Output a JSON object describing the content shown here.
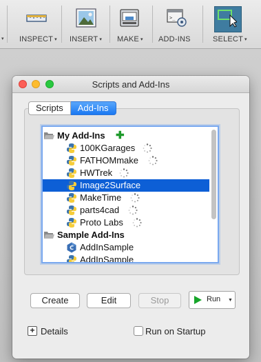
{
  "toolbar": {
    "items": [
      {
        "label": "INSPECT",
        "icon": "ruler-icon",
        "has_menu": true
      },
      {
        "label": "INSERT",
        "icon": "image-icon",
        "has_menu": true
      },
      {
        "label": "MAKE",
        "icon": "printer-icon",
        "has_menu": true
      },
      {
        "label": "ADD-INS",
        "icon": "script-gear-icon",
        "has_menu": false
      },
      {
        "label": "SELECT",
        "icon": "select-arrow-icon",
        "has_menu": true,
        "active": true
      }
    ],
    "caret": "▾"
  },
  "dialog": {
    "title": "Scripts and Add-Ins",
    "tabs": [
      {
        "label": "Scripts",
        "active": false
      },
      {
        "label": "Add-Ins",
        "active": true
      }
    ],
    "tree": {
      "groups": [
        {
          "label": "My Add-Ins",
          "has_add": true,
          "items": [
            {
              "label": "100KGarages",
              "icon": "python-icon",
              "loading": true
            },
            {
              "label": "FATHOMmake",
              "icon": "python-icon",
              "loading": true
            },
            {
              "label": "HWTrek",
              "icon": "python-icon",
              "loading": true
            },
            {
              "label": "Image2Surface",
              "icon": "python-icon",
              "loading": false,
              "selected": true
            },
            {
              "label": "MakeTime",
              "icon": "python-icon",
              "loading": true
            },
            {
              "label": "parts4cad",
              "icon": "python-icon",
              "loading": true
            },
            {
              "label": "Proto Labs",
              "icon": "python-icon",
              "loading": true
            }
          ]
        },
        {
          "label": "Sample Add-Ins",
          "has_add": false,
          "items": [
            {
              "label": "AddInSample",
              "icon": "cpp-icon",
              "loading": false
            },
            {
              "label": "AddInSample",
              "icon": "python-icon",
              "loading": false
            }
          ]
        }
      ]
    },
    "buttons": {
      "create": "Create",
      "edit": "Edit",
      "stop": "Stop",
      "run": "Run"
    },
    "details_label": "Details",
    "run_on_startup_label": "Run on Startup",
    "run_on_startup_checked": false
  },
  "colors": {
    "selection": "#0d5fd6",
    "tab_active": "#1a78f2",
    "run_green": "#17a52a",
    "add_green": "#1e9a2b"
  }
}
